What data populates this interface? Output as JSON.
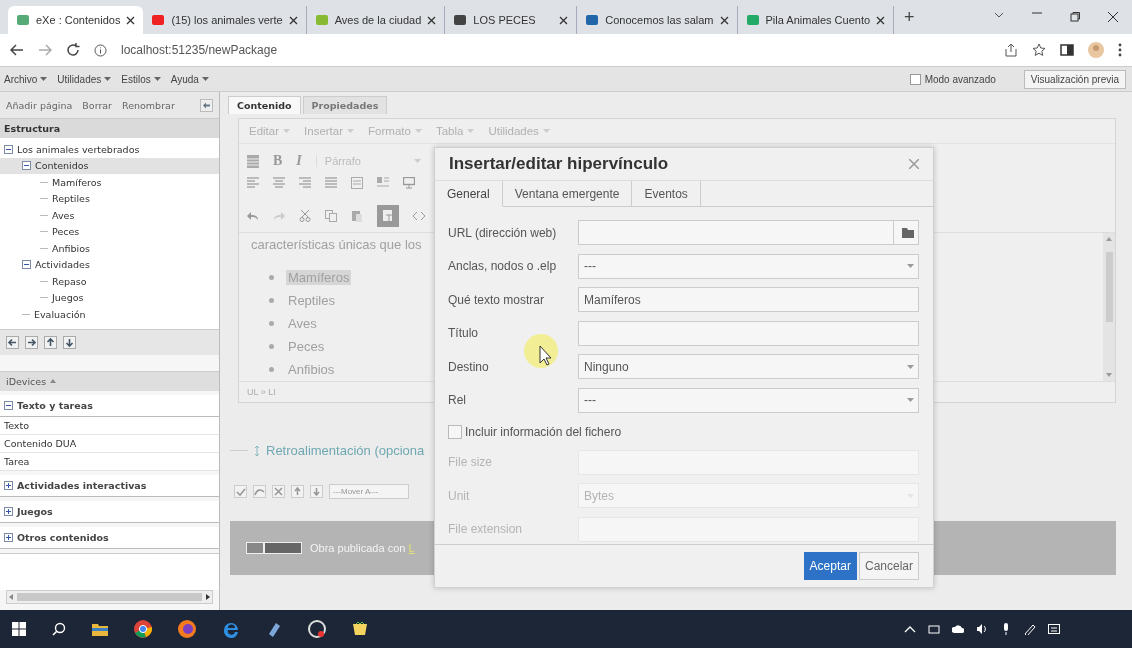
{
  "browser": {
    "tabs": [
      {
        "title": "eXe : Contenidos",
        "selected": true
      },
      {
        "title": "(15) los animales verte",
        "selected": false
      },
      {
        "title": "Aves de la ciudad",
        "selected": false
      },
      {
        "title": "LOS PECES",
        "selected": false
      },
      {
        "title": "Conocemos las salam",
        "selected": false
      },
      {
        "title": "Pila Animales Cuento",
        "selected": false
      }
    ],
    "new_tab": "+",
    "address": "localhost:51235/newPackage"
  },
  "menu_bar": {
    "items": [
      "Archivo",
      "Utilidades",
      "Estilos",
      "Ayuda"
    ],
    "advanced_mode": {
      "label": "Modo avanzado",
      "checked": false
    },
    "preview_button": "Visualización previa"
  },
  "sidebar": {
    "actions": [
      "Añadir página",
      "Borrar",
      "Renombrar"
    ],
    "structure_title": "Estructura",
    "tree": [
      {
        "label": "Los animales vertebrados",
        "expanded": true,
        "selected": false,
        "children": [
          {
            "label": "Contenidos",
            "expanded": true,
            "selected": true,
            "children": [
              {
                "label": "Mamíferos",
                "selected": false
              },
              {
                "label": "Reptiles",
                "selected": false
              },
              {
                "label": "Aves",
                "selected": false
              },
              {
                "label": "Peces",
                "selected": false
              },
              {
                "label": "Anfibios",
                "selected": false
              }
            ]
          },
          {
            "label": "Actividades",
            "expanded": true,
            "selected": false,
            "children": [
              {
                "label": "Repaso",
                "selected": false
              },
              {
                "label": "Juegos",
                "selected": false
              }
            ]
          },
          {
            "label": "Evaluación",
            "selected": false
          }
        ]
      }
    ],
    "idevices_title": "iDevices",
    "idevice_groups": [
      {
        "label": "Texto y tareas",
        "expanded": true,
        "items": [
          "Texto",
          "Contenido DUA",
          "Tarea"
        ]
      },
      {
        "label": "Actividades interactivas",
        "expanded": false
      },
      {
        "label": "Juegos",
        "expanded": false
      },
      {
        "label": "Otros contenidos",
        "expanded": false
      }
    ]
  },
  "content_tabs": [
    {
      "label": "Contenido",
      "selected": true
    },
    {
      "label": "Propiedades",
      "selected": false
    }
  ],
  "editor": {
    "menu": [
      "Editar",
      "Insertar",
      "Formato",
      "Tabla",
      "Utilidades"
    ],
    "format_buttons": [
      "B",
      "I"
    ],
    "block_format": "Párrafo",
    "text": "características únicas que los",
    "list": [
      {
        "text": "Mamíferos",
        "selected": true
      },
      {
        "text": "Reptiles",
        "selected": false
      },
      {
        "text": "Aves",
        "selected": false
      },
      {
        "text": "Peces",
        "selected": false
      },
      {
        "text": "Anfibios",
        "selected": false
      }
    ],
    "path": "UL » LI",
    "feedback": "Retroalimentación (opciona",
    "move_select": "---Mover A---"
  },
  "footer": {
    "text": "Obra publicada con",
    "link": "L"
  },
  "dialog": {
    "title": "Insertar/editar hipervínculo",
    "tabs": [
      {
        "label": "General",
        "selected": true
      },
      {
        "label": "Ventana emergente",
        "selected": false
      },
      {
        "label": "Eventos",
        "selected": false
      }
    ],
    "fields": [
      {
        "kind": "url",
        "label": "URL (dirección web)"
      },
      {
        "kind": "select",
        "label": "Anclas, nodos o .elp",
        "value": "---"
      },
      {
        "kind": "text",
        "label": "Qué texto mostrar",
        "value": "Mamíferos"
      },
      {
        "kind": "text",
        "label": "Título"
      },
      {
        "kind": "select",
        "label": "Destino",
        "value": "Ninguno"
      },
      {
        "kind": "select",
        "label": "Rel",
        "value": "---"
      },
      {
        "kind": "checkbox",
        "label": "Incluir información del fichero",
        "checked": false
      },
      {
        "kind": "text",
        "label": "File size",
        "disabled": true
      },
      {
        "kind": "select",
        "label": "Unit",
        "value": "Bytes",
        "disabled": true
      },
      {
        "kind": "text",
        "label": "File extension",
        "disabled": true
      }
    ],
    "buttons": [
      {
        "label": "Aceptar",
        "primary": true
      },
      {
        "label": "Cancelar",
        "primary": false
      }
    ]
  }
}
